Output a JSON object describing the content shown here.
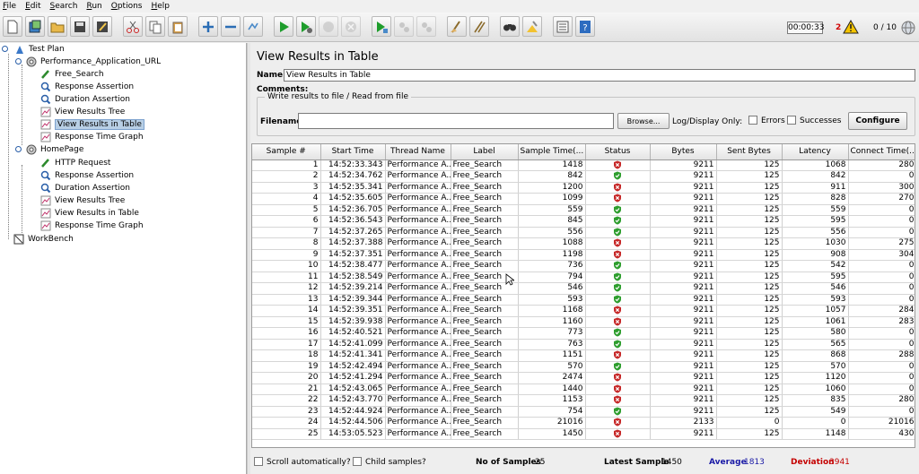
{
  "menu": [
    "File",
    "Edit",
    "Search",
    "Run",
    "Options",
    "Help"
  ],
  "toolbar": {
    "timer": "00:00:33",
    "error_count": "2",
    "threads": "0 / 10",
    "icons": [
      "new-icon",
      "templates-icon",
      "open-icon",
      "save-icon",
      "save-as-icon",
      "cut-icon",
      "copy-icon",
      "paste-icon",
      "expand-icon",
      "collapse-icon",
      "toggle-icon",
      "start-icon",
      "start-no-pause-icon",
      "stop-icon",
      "shutdown-icon",
      "remote-start-icon",
      "remote-stop-icon",
      "remote-shutdown-icon",
      "clear-icon",
      "clear-all-icon",
      "search-icon",
      "reset-search-icon",
      "function-helper-icon",
      "help-icon"
    ]
  },
  "tree": {
    "items": [
      {
        "label": "Test Plan",
        "icon": "test-plan-icon"
      },
      {
        "label": "Performance_Application_URL",
        "icon": "thread-group-icon"
      },
      {
        "label": "Free_Search",
        "icon": "sampler-icon"
      },
      {
        "label": "Response Assertion",
        "icon": "assertion-icon"
      },
      {
        "label": "Duration Assertion",
        "icon": "assertion-icon"
      },
      {
        "label": "View Results Tree",
        "icon": "listener-icon"
      },
      {
        "label": "View Results in Table",
        "icon": "listener-icon"
      },
      {
        "label": "Response Time Graph",
        "icon": "listener-icon"
      },
      {
        "label": "HomePage",
        "icon": "thread-group-icon"
      },
      {
        "label": "HTTP Request",
        "icon": "sampler-icon"
      },
      {
        "label": "Response Assertion",
        "icon": "assertion-icon"
      },
      {
        "label": "Duration Assertion",
        "icon": "assertion-icon"
      },
      {
        "label": "View Results Tree",
        "icon": "listener-icon"
      },
      {
        "label": "View Results in Table",
        "icon": "listener-icon"
      },
      {
        "label": "Response Time Graph",
        "icon": "listener-icon"
      },
      {
        "label": "WorkBench",
        "icon": "workbench-icon"
      }
    ]
  },
  "panel": {
    "title": "View Results in Table",
    "name_label": "Name:",
    "name_value": "View Results in Table",
    "comments_label": "Comments:",
    "file_section": "Write results to file / Read from file",
    "filename_label": "Filename",
    "browse_label": "Browse...",
    "log_display_label": "Log/Display Only:",
    "errors_label": "Errors",
    "successes_label": "Successes",
    "configure_label": "Configure"
  },
  "table": {
    "columns": [
      "Sample #",
      "Start Time",
      "Thread Name",
      "Label",
      "Sample Time(...",
      "Status",
      "Bytes",
      "Sent Bytes",
      "Latency",
      "Connect Time(..."
    ],
    "rows": [
      [
        "1",
        "14:52:33.343",
        "Performance A...",
        "Free_Search",
        "1418",
        "fail",
        "9211",
        "125",
        "1068",
        "280"
      ],
      [
        "2",
        "14:52:34.762",
        "Performance A...",
        "Free_Search",
        "842",
        "pass",
        "9211",
        "125",
        "842",
        "0"
      ],
      [
        "3",
        "14:52:35.341",
        "Performance A...",
        "Free_Search",
        "1200",
        "fail",
        "9211",
        "125",
        "911",
        "300"
      ],
      [
        "4",
        "14:52:35.605",
        "Performance A...",
        "Free_Search",
        "1099",
        "fail",
        "9211",
        "125",
        "828",
        "270"
      ],
      [
        "5",
        "14:52:36.705",
        "Performance A...",
        "Free_Search",
        "559",
        "pass",
        "9211",
        "125",
        "559",
        "0"
      ],
      [
        "6",
        "14:52:36.543",
        "Performance A...",
        "Free_Search",
        "845",
        "pass",
        "9211",
        "125",
        "595",
        "0"
      ],
      [
        "7",
        "14:52:37.265",
        "Performance A...",
        "Free_Search",
        "556",
        "pass",
        "9211",
        "125",
        "556",
        "0"
      ],
      [
        "8",
        "14:52:37.388",
        "Performance A...",
        "Free_Search",
        "1088",
        "fail",
        "9211",
        "125",
        "1030",
        "275"
      ],
      [
        "9",
        "14:52:37.351",
        "Performance A...",
        "Free_Search",
        "1198",
        "fail",
        "9211",
        "125",
        "908",
        "304"
      ],
      [
        "10",
        "14:52:38.477",
        "Performance A...",
        "Free_Search",
        "736",
        "pass",
        "9211",
        "125",
        "542",
        "0"
      ],
      [
        "11",
        "14:52:38.549",
        "Performance A...",
        "Free_Search",
        "794",
        "pass",
        "9211",
        "125",
        "595",
        "0"
      ],
      [
        "12",
        "14:52:39.214",
        "Performance A...",
        "Free_Search",
        "546",
        "pass",
        "9211",
        "125",
        "546",
        "0"
      ],
      [
        "13",
        "14:52:39.344",
        "Performance A...",
        "Free_Search",
        "593",
        "pass",
        "9211",
        "125",
        "593",
        "0"
      ],
      [
        "14",
        "14:52:39.351",
        "Performance A...",
        "Free_Search",
        "1168",
        "fail",
        "9211",
        "125",
        "1057",
        "284"
      ],
      [
        "15",
        "14:52:39.938",
        "Performance A...",
        "Free_Search",
        "1160",
        "fail",
        "9211",
        "125",
        "1061",
        "283"
      ],
      [
        "16",
        "14:52:40.521",
        "Performance A...",
        "Free_Search",
        "773",
        "pass",
        "9211",
        "125",
        "580",
        "0"
      ],
      [
        "17",
        "14:52:41.099",
        "Performance A...",
        "Free_Search",
        "763",
        "pass",
        "9211",
        "125",
        "565",
        "0"
      ],
      [
        "18",
        "14:52:41.341",
        "Performance A...",
        "Free_Search",
        "1151",
        "fail",
        "9211",
        "125",
        "868",
        "288"
      ],
      [
        "19",
        "14:52:42.494",
        "Performance A...",
        "Free_Search",
        "570",
        "pass",
        "9211",
        "125",
        "570",
        "0"
      ],
      [
        "20",
        "14:52:41.294",
        "Performance A...",
        "Free_Search",
        "2474",
        "fail",
        "9211",
        "125",
        "1120",
        "0"
      ],
      [
        "21",
        "14:52:43.065",
        "Performance A...",
        "Free_Search",
        "1440",
        "fail",
        "9211",
        "125",
        "1060",
        "0"
      ],
      [
        "22",
        "14:52:43.770",
        "Performance A...",
        "Free_Search",
        "1153",
        "fail",
        "9211",
        "125",
        "835",
        "280"
      ],
      [
        "23",
        "14:52:44.924",
        "Performance A...",
        "Free_Search",
        "754",
        "pass",
        "9211",
        "125",
        "549",
        "0"
      ],
      [
        "24",
        "14:52:44.506",
        "Performance A...",
        "Free_Search",
        "21016",
        "fail",
        "2133",
        "0",
        "0",
        "21016"
      ],
      [
        "25",
        "14:53:05.523",
        "Performance A...",
        "Free_Search",
        "1450",
        "fail",
        "9211",
        "125",
        "1148",
        "430"
      ]
    ]
  },
  "footer": {
    "scroll_label": "Scroll automatically?",
    "child_label": "Child samples?",
    "no_samples_label": "No of Samples",
    "no_samples_value": "25",
    "latest_label": "Latest Sample",
    "latest_value": "1450",
    "average_label": "Average",
    "average_value": "1813",
    "deviation_label": "Deviation",
    "deviation_value": "3941"
  },
  "colors": {
    "average": "#1a1aa6",
    "deviation": "#c40000",
    "pass": "#2e9e2e",
    "fail": "#c62828",
    "selection": "#b8cfe5"
  }
}
